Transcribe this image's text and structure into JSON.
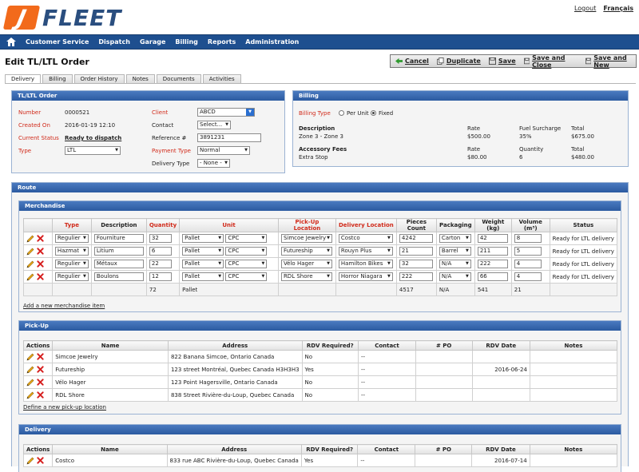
{
  "header": {
    "logo_letter": "J",
    "logo_text": "FLEET",
    "logout": "Logout",
    "language": "Français"
  },
  "nav": {
    "items": [
      "Customer Service",
      "Dispatch",
      "Garage",
      "Billing",
      "Reports",
      "Administration"
    ]
  },
  "page": {
    "title": "Edit TL/LTL Order"
  },
  "toolbar": {
    "cancel": "Cancel",
    "duplicate": "Duplicate",
    "save": "Save",
    "save_close": "Save and Close",
    "save_new": "Save and New"
  },
  "tabs": [
    "Delivery",
    "Billing",
    "Order History",
    "Notes",
    "Documents",
    "Activities"
  ],
  "order": {
    "panel_title": "TL/LTL Order",
    "number_label": "Number",
    "number": "0000521",
    "created_label": "Created On",
    "created": "2016-01-19 12:10",
    "status_label": "Current Status",
    "status": "Ready to dispatch",
    "type_label": "Type",
    "type": "LTL",
    "client_label": "Client",
    "client": "ABCD",
    "contact_label": "Contact",
    "contact": "Select...",
    "reference_label": "Reference #",
    "reference": "3891231",
    "payment_label": "Payment Type",
    "payment": "Normal",
    "delivery_type_label": "Delivery Type",
    "delivery_type": "- None -"
  },
  "billing": {
    "panel_title": "Billing",
    "billing_type_label": "Billing Type",
    "per_unit": "Per Unit",
    "fixed": "Fixed",
    "description_label": "Description",
    "description": "Zone 3 - Zone 3",
    "rate_label": "Rate",
    "rate": "$500.00",
    "fuel_label": "Fuel Surcharge",
    "fuel": "35%",
    "total_label": "Total",
    "total": "$675.00",
    "accessory_label": "Accessory Fees",
    "accessory": "Extra Stop",
    "acc_rate_label": "Rate",
    "acc_rate": "$80.00",
    "qty_label": "Quantity",
    "qty": "6",
    "acc_total_label": "Total",
    "acc_total": "$480.00"
  },
  "route": {
    "panel_title": "Route"
  },
  "merchandise": {
    "panel_title": "Merchandise",
    "headers": [
      "",
      "Type",
      "Description",
      "Quantity",
      "Unit",
      "Pick-Up Location",
      "Delivery Location",
      "Pieces Count",
      "Packaging",
      "Weight (kg)",
      "Volume (m³)",
      "Status"
    ],
    "rows": [
      {
        "type": "Regulier",
        "description": "Fourniture",
        "quantity": "32",
        "unit": "Pallet",
        "unit2": "CPC",
        "pickup": "Simcoe Jewelry",
        "delivery": "Costco",
        "pieces": "4242",
        "packaging": "Carton",
        "weight": "42",
        "volume": "8",
        "status": "Ready for LTL delivery"
      },
      {
        "type": "Hazmat",
        "description": "Litium",
        "quantity": "6",
        "unit": "Pallet",
        "unit2": "CPC",
        "pickup": "Futureship",
        "delivery": "Rouyn Plus",
        "pieces": "21",
        "packaging": "Barrel",
        "weight": "211",
        "volume": "5",
        "status": "Ready for LTL delivery"
      },
      {
        "type": "Regulier",
        "description": "Métaux",
        "quantity": "22",
        "unit": "Pallet",
        "unit2": "CPC",
        "pickup": "Vélo Hager",
        "delivery": "Hamilton Bikes",
        "pieces": "32",
        "packaging": "N/A",
        "weight": "222",
        "volume": "4",
        "status": "Ready for LTL delivery"
      },
      {
        "type": "Regulier",
        "description": "Boulons",
        "quantity": "12",
        "unit": "Pallet",
        "unit2": "CPC",
        "pickup": "RDL Shore",
        "delivery": "Horror Niagara",
        "pieces": "222",
        "packaging": "N/A",
        "weight": "66",
        "volume": "4",
        "status": "Ready for LTL delivery"
      }
    ],
    "totals": {
      "quantity": "72",
      "unit": "Pallet",
      "pieces": "4517",
      "packaging": "N/A",
      "weight": "541",
      "volume": "21"
    },
    "add_link": "Add a new merchandise item"
  },
  "pickup": {
    "panel_title": "Pick-Up",
    "headers": [
      "Actions",
      "Name",
      "Address",
      "RDV Required?",
      "Contact",
      "# PO",
      "RDV Date",
      "Notes"
    ],
    "rows": [
      {
        "name": "Simcoe Jewelry",
        "address": "822 Banana Simcoe, Ontario Canada",
        "rdv": "No",
        "contact": "--",
        "po": "",
        "date": "",
        "notes": ""
      },
      {
        "name": "Futureship",
        "address": "123 street Montréal, Quebec Canada H3H3H3",
        "rdv": "Yes",
        "contact": "--",
        "po": "",
        "date": "2016-06-24",
        "notes": ""
      },
      {
        "name": "Vélo Hager",
        "address": "123 Point Hagersville, Ontario Canada",
        "rdv": "No",
        "contact": "--",
        "po": "",
        "date": "",
        "notes": ""
      },
      {
        "name": "RDL Shore",
        "address": "838 Street Rivière-du-Loup, Quebec Canada",
        "rdv": "No",
        "contact": "--",
        "po": "",
        "date": "",
        "notes": ""
      }
    ],
    "add_link": "Define a new pick-up location"
  },
  "delivery": {
    "panel_title": "Delivery",
    "headers": [
      "Actions",
      "Name",
      "Address",
      "RDV Required?",
      "Contact",
      "# PO",
      "RDV Date",
      "Notes"
    ],
    "rows": [
      {
        "name": "Costco",
        "address": "833 rue ABC Rivière-du-Loup, Quebec Canada",
        "rdv": "Yes",
        "contact": "--",
        "po": "",
        "date": "2016-07-14",
        "notes": ""
      }
    ]
  },
  "colors": {
    "brand_orange": "#f26a1b",
    "brand_blue": "#2a4e7f",
    "nav_blue": "#1e4f8f",
    "required_red": "#d12a1a"
  },
  "icons": [
    "home-icon",
    "cancel-arrow-icon",
    "duplicate-icon",
    "save-icon",
    "pencil-icon",
    "delete-x-icon"
  ]
}
